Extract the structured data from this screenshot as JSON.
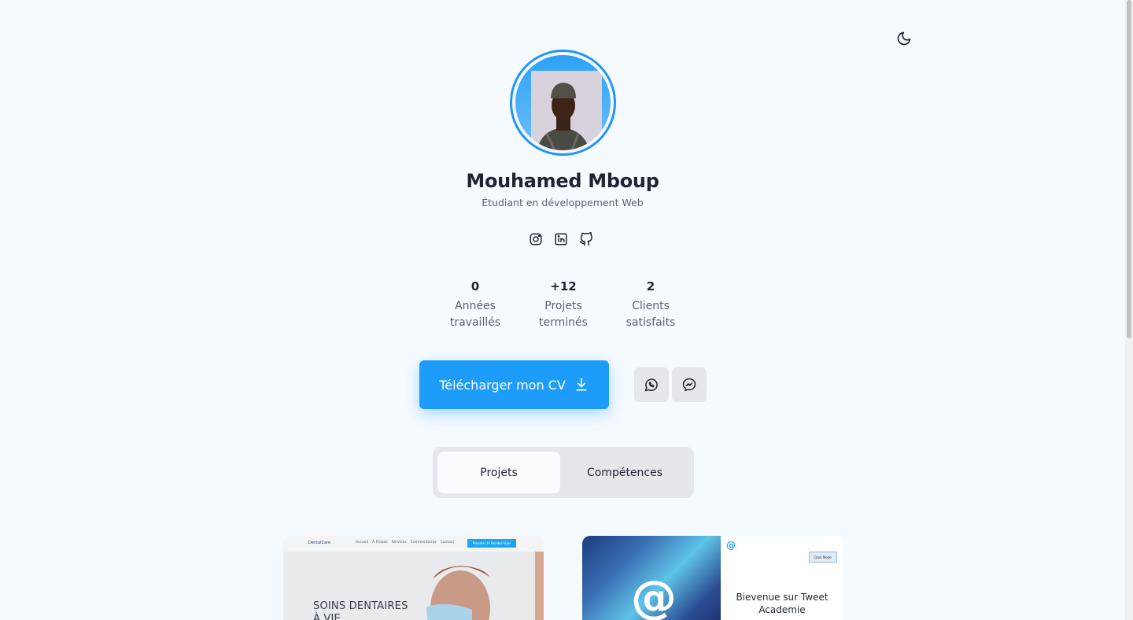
{
  "profile": {
    "name": "Mouhamed Mboup",
    "role": "Étudiant en développement Web"
  },
  "icons": {
    "theme": "moon-icon",
    "socials": [
      "instagram-icon",
      "linkedin-icon",
      "github-icon"
    ],
    "download": "download-icon",
    "whatsapp": "whatsapp-icon",
    "messenger": "messenger-icon"
  },
  "stats": [
    {
      "value": "0",
      "label_line1": "Années",
      "label_line2": "travaillés"
    },
    {
      "value": "+12",
      "label_line1": "Projets",
      "label_line2": "terminés"
    },
    {
      "value": "2",
      "label_line1": "Clients",
      "label_line2": "satisfaits"
    }
  ],
  "actions": {
    "download_cv": "Télécharger mon CV"
  },
  "tabs": [
    {
      "label": "Projets",
      "active": true
    },
    {
      "label": "Compétences",
      "active": false
    }
  ],
  "projects": [
    {
      "logo": "DentalCare",
      "nav": [
        "Accueil",
        "À Propos",
        "Services",
        "Commentaires",
        "Contact"
      ],
      "cta": "Prendre Un Rendez-Vous",
      "title_line1": "SOINS DENTAIRES",
      "title_line2": "À VIE"
    },
    {
      "badge": "@",
      "button": "Dark Mode",
      "title_line1": "Bievenue sur Tweet",
      "title_line2": "Academie"
    }
  ],
  "colors": {
    "accent": "#1e9cfa",
    "background": "#f5faff",
    "text": "#1f2430",
    "muted": "#5a6270"
  }
}
